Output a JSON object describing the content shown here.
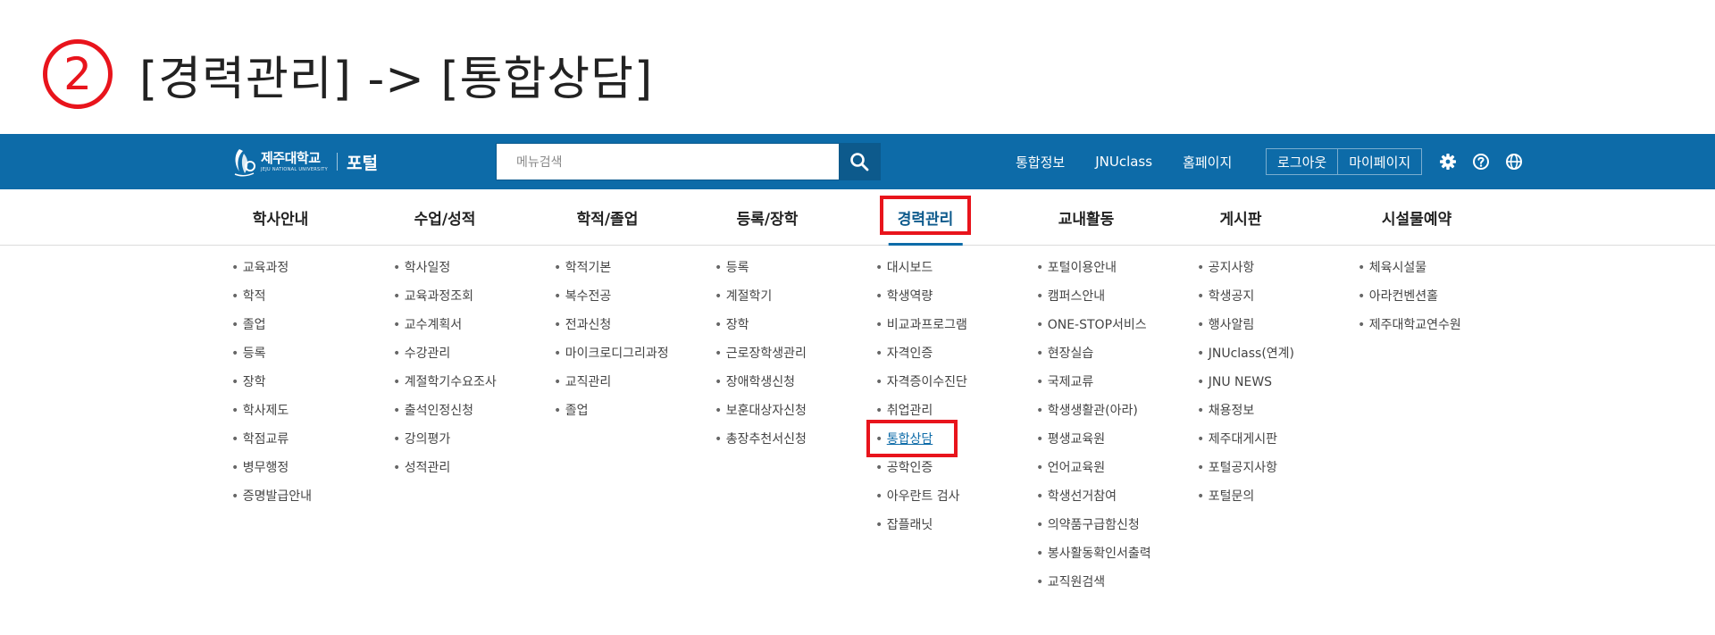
{
  "step": {
    "number": "2",
    "title": "[경력관리] -> [통합상담]"
  },
  "header": {
    "logo_name": "제주대학교",
    "logo_sub": "JEJU NATIONAL UNIVERSITY",
    "logo_portal": "포털",
    "search_placeholder": "메뉴검색",
    "links": [
      "통합정보",
      "JNUclass",
      "홈페이지"
    ],
    "logout": "로그아웃",
    "mypage": "마이페이지",
    "icons": [
      "gear-icon",
      "help-icon",
      "globe-icon"
    ],
    "accent_color": "#0d6ba8"
  },
  "nav": {
    "items": [
      "학사안내",
      "수업/성적",
      "학적/졸업",
      "등록/장학",
      "경력관리",
      "교내활동",
      "게시판",
      "시설물예약"
    ],
    "active": "경력관리"
  },
  "menus": [
    [
      "교육과정",
      "학적",
      "졸업",
      "등록",
      "장학",
      "학사제도",
      "학점교류",
      "병무행정",
      "증명발급안내"
    ],
    [
      "학사일정",
      "교육과정조회",
      "교수계획서",
      "수강관리",
      "계절학기수요조사",
      "출석인정신청",
      "강의평가",
      "성적관리"
    ],
    [
      "학적기본",
      "복수전공",
      "전과신청",
      "마이크로디그리과정",
      "교직관리",
      "졸업"
    ],
    [
      "등록",
      "계절학기",
      "장학",
      "근로장학생관리",
      "장애학생신청",
      "보훈대상자신청",
      "총장추천서신청"
    ],
    [
      "대시보드",
      "학생역량",
      "비교과프로그램",
      "자격인증",
      "자격증이수진단",
      "취업관리",
      "통합상담",
      "공학인증",
      "아우란트 검사",
      "잡플래닛"
    ],
    [
      "포털이용안내",
      "캠퍼스안내",
      "ONE-STOP서비스",
      "현장실습",
      "국제교류",
      "학생생활관(아라)",
      "평생교육원",
      "언어교육원",
      "학생선거참여",
      "의약품구급함신청",
      "봉사활동확인서출력",
      "교직원검색"
    ],
    [
      "공지사항",
      "학생공지",
      "행사알림",
      "JNUclass(연계)",
      "JNU NEWS",
      "채용정보",
      "제주대게시판",
      "포털공지사항",
      "포털문의"
    ],
    [
      "체육시설물",
      "아라컨벤션홀",
      "제주대학교연수원"
    ]
  ],
  "highlight_color": "#e8141c"
}
